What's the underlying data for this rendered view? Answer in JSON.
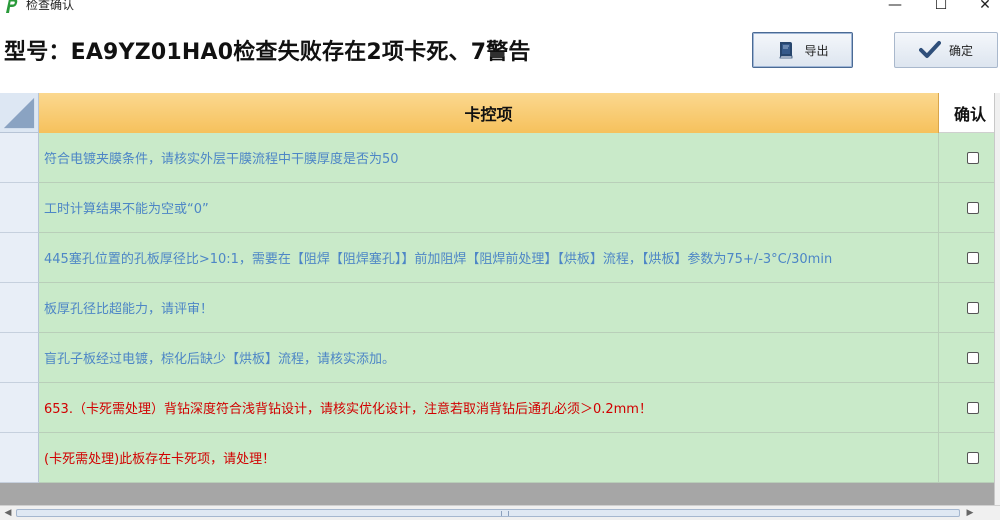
{
  "window": {
    "title": "检查确认",
    "controls": {
      "minimize": "—",
      "maximize": "☐",
      "close": "✕"
    }
  },
  "header": {
    "heading": "型号：EA9YZ01HA0检查失败存在2项卡死、7警告",
    "export_label": "导出",
    "confirm_label": "确定"
  },
  "grid": {
    "columns": {
      "item": "卡控项",
      "confirm": "确认"
    },
    "rows": [
      {
        "text": "符合电镀夹膜条件，请核实外层干膜流程中干膜厚度是否为50",
        "level": "warning",
        "checked": false
      },
      {
        "text": "工时计算结果不能为空或“0”",
        "level": "warning",
        "checked": false
      },
      {
        "text": "445塞孔位置的孔板厚径比>10:1，需要在【阻焊【阻焊塞孔】】前加阻焊【阻焊前处理】【烘板】流程，【烘板】参数为75+/-3°C/30min",
        "level": "warning",
        "checked": false
      },
      {
        "text": "板厚孔径比超能力，请评审！",
        "level": "warning",
        "checked": false
      },
      {
        "text": "盲孔子板经过电镀，棕化后缺少【烘板】流程，请核实添加。",
        "level": "warning",
        "checked": false
      },
      {
        "text": "653.（卡死需处理）背钻深度符合浅背钻设计，请核实优化设计，注意若取消背钻后通孔必须＞0.2mm！",
        "level": "error",
        "checked": false
      },
      {
        "text": "(卡死需处理)此板存在卡死项，请处理！",
        "level": "error",
        "checked": false
      }
    ]
  },
  "colors": {
    "warning_text": "#4d86c6",
    "error_text": "#d10000",
    "row_background": "#c9eac9",
    "header_background": "#f6c15c"
  }
}
